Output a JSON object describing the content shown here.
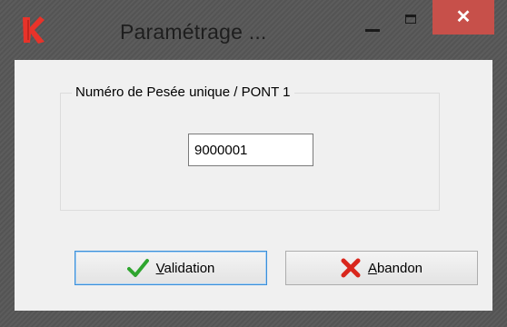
{
  "window": {
    "title": "Paramétrage ...",
    "close_glyph": "✕"
  },
  "form": {
    "group_label": "Numéro de Pesée unique / PONT 1",
    "weighing_number": "9000001"
  },
  "buttons": {
    "validation": {
      "accel": "V",
      "rest": "alidation"
    },
    "abandon": {
      "accel": "A",
      "rest": "bandon"
    }
  },
  "colors": {
    "close_button": "#c7504a",
    "check_icon": "#2fa52f",
    "cross_icon": "#d9261c",
    "app_icon": "#e8332a",
    "focus_border": "#3c8fd8"
  },
  "icons": {
    "app": "app-logo-icon",
    "validation": "check-icon",
    "abandon": "cross-icon"
  }
}
